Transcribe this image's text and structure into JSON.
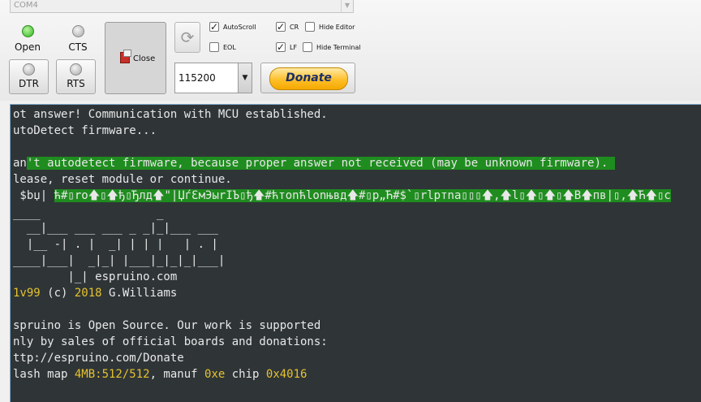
{
  "toolbar": {
    "port": "COM4",
    "leds": {
      "open": {
        "label": "Open",
        "state": "on",
        "color": "#2db51d"
      },
      "cts": {
        "label": "CTS",
        "state": "off"
      }
    },
    "buttons": {
      "dtr": "DTR",
      "rts": "RTS",
      "close": "Close",
      "donate": "Donate"
    },
    "checkboxes": {
      "autoscroll": {
        "label": "AutoScroll",
        "checked": true
      },
      "eol": {
        "label": "EOL",
        "checked": false
      },
      "cr": {
        "label": "CR",
        "checked": true
      },
      "lf": {
        "label": "LF",
        "checked": true
      },
      "hide_editor": {
        "label": "Hide Editor",
        "checked": false
      },
      "hide_terminal": {
        "label": "Hide Terminal",
        "checked": false
      }
    },
    "baud_rate": "115200"
  },
  "terminal": {
    "bg_color": "#2f3537",
    "highlight_color": "#1f8c1f",
    "number_color": "#e6c22e",
    "lines": {
      "l1": "ot answer! Communication with MCU established.",
      "l2": "utoDetect firmware...",
      "l3a": "an",
      "l3b": "'t autodetect firmware, because proper answer not received (may be unknown firmware). ",
      "l4": "lease, reset module or continue.",
      "l5a": " $bџ| ",
      "l5b": "ћ#▯ro🡅▯🡅ђ▯Ђлд🡅\"|ЏѓԐмЭыrІЪ▯ђ🡅#ћтonћlonњвд🡅#▯р„Ћ#$`▯rlртnа▯▯▯🡅,🡅l▯🡅▯🡅▯🡅В🡅пв|▯,🡅Ћ🡅▯c",
      "l6": "____                 _",
      "l7": "  __|___ ___ ___ _ _|_|___ ___",
      "l8": "  |__ -| . |  _| | | |   | . |",
      "l9": "____|___|  _|_| |___|_|_|_|___|",
      "l10": "        |_| espruino.com",
      "l11a": "1v99",
      "l11b": " (c) ",
      "l11c": "2018",
      "l11d": " G.Williams",
      "l12": "spruino is Open Source. Our work is supported",
      "l13": "nly by sales of official boards and donations:",
      "l14": "ttp://espruino.com/Donate",
      "l15a": "lash map ",
      "l15b": "4MB:512/512",
      "l15c": ", manuf ",
      "l15d": "0xe",
      "l15e": " chip ",
      "l15f": "0x4016"
    }
  }
}
